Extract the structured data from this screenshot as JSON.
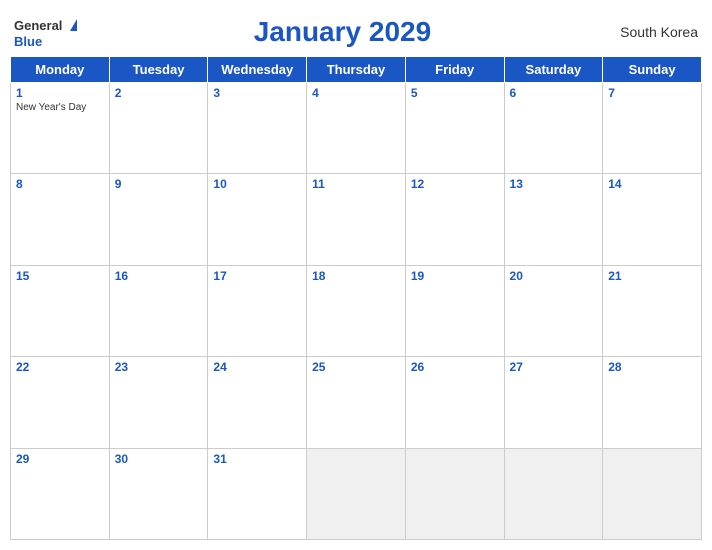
{
  "header": {
    "logo_general": "General",
    "logo_blue": "Blue",
    "title": "January 2029",
    "country": "South Korea"
  },
  "days_of_week": [
    "Monday",
    "Tuesday",
    "Wednesday",
    "Thursday",
    "Friday",
    "Saturday",
    "Sunday"
  ],
  "weeks": [
    [
      {
        "day": "1",
        "holiday": "New Year's Day"
      },
      {
        "day": "2",
        "holiday": ""
      },
      {
        "day": "3",
        "holiday": ""
      },
      {
        "day": "4",
        "holiday": ""
      },
      {
        "day": "5",
        "holiday": ""
      },
      {
        "day": "6",
        "holiday": ""
      },
      {
        "day": "7",
        "holiday": ""
      }
    ],
    [
      {
        "day": "8",
        "holiday": ""
      },
      {
        "day": "9",
        "holiday": ""
      },
      {
        "day": "10",
        "holiday": ""
      },
      {
        "day": "11",
        "holiday": ""
      },
      {
        "day": "12",
        "holiday": ""
      },
      {
        "day": "13",
        "holiday": ""
      },
      {
        "day": "14",
        "holiday": ""
      }
    ],
    [
      {
        "day": "15",
        "holiday": ""
      },
      {
        "day": "16",
        "holiday": ""
      },
      {
        "day": "17",
        "holiday": ""
      },
      {
        "day": "18",
        "holiday": ""
      },
      {
        "day": "19",
        "holiday": ""
      },
      {
        "day": "20",
        "holiday": ""
      },
      {
        "day": "21",
        "holiday": ""
      }
    ],
    [
      {
        "day": "22",
        "holiday": ""
      },
      {
        "day": "23",
        "holiday": ""
      },
      {
        "day": "24",
        "holiday": ""
      },
      {
        "day": "25",
        "holiday": ""
      },
      {
        "day": "26",
        "holiday": ""
      },
      {
        "day": "27",
        "holiday": ""
      },
      {
        "day": "28",
        "holiday": ""
      }
    ],
    [
      {
        "day": "29",
        "holiday": ""
      },
      {
        "day": "30",
        "holiday": ""
      },
      {
        "day": "31",
        "holiday": ""
      },
      {
        "day": "",
        "holiday": ""
      },
      {
        "day": "",
        "holiday": ""
      },
      {
        "day": "",
        "holiday": ""
      },
      {
        "day": "",
        "holiday": ""
      }
    ]
  ]
}
